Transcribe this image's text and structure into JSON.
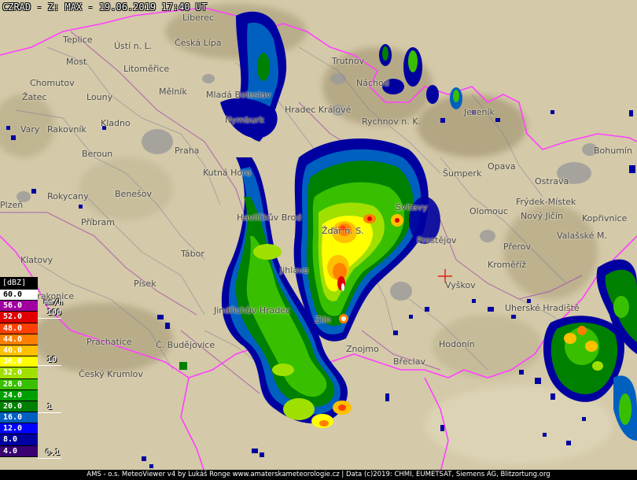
{
  "header": {
    "title": "CZRAD - Z: MAX - 19.06.2019 17:40 UT"
  },
  "legend": {
    "unit": "[dBZ]",
    "rate_unit": "mm/h",
    "levels": [
      {
        "label": "60.0",
        "color": "#ffffff",
        "text": "#000000"
      },
      {
        "label": "56.0",
        "color": "#a000a0",
        "text": "#ffffff"
      },
      {
        "label": "52.0",
        "color": "#e00000",
        "text": "#ffffff"
      },
      {
        "label": "48.0",
        "color": "#ff4000",
        "text": "#ffffff"
      },
      {
        "label": "44.0",
        "color": "#ff8000",
        "text": "#ffffff"
      },
      {
        "label": "40.0",
        "color": "#ffc000",
        "text": "#ffffff"
      },
      {
        "label": "36.0",
        "color": "#ffff00",
        "text": "#ffffff"
      },
      {
        "label": "32.0",
        "color": "#a0e000",
        "text": "#ffffff"
      },
      {
        "label": "28.0",
        "color": "#38c000",
        "text": "#ffffff"
      },
      {
        "label": "24.0",
        "color": "#00a000",
        "text": "#ffffff"
      },
      {
        "label": "20.0",
        "color": "#008000",
        "text": "#ffffff"
      },
      {
        "label": "16.0",
        "color": "#0060c0",
        "text": "#ffffff"
      },
      {
        "label": "12.0",
        "color": "#0000ff",
        "text": "#ffffff"
      },
      {
        "label": "8.0",
        "color": "#0000a0",
        "text": "#ffffff"
      },
      {
        "label": "4.0",
        "color": "#380070",
        "text": "#ffffff"
      }
    ],
    "rates": [
      "100",
      "10",
      "1",
      "0.1"
    ]
  },
  "cities": [
    {
      "name": "Liberec"
    },
    {
      "name": "Teplice"
    },
    {
      "name": "Ústí n. L."
    },
    {
      "name": "Česká Lípa"
    },
    {
      "name": "Most"
    },
    {
      "name": "Chomutov"
    },
    {
      "name": "Litoměřice"
    },
    {
      "name": "Trutnov"
    },
    {
      "name": "Náchod"
    },
    {
      "name": "Žatec"
    },
    {
      "name": "Louny"
    },
    {
      "name": "Mělník"
    },
    {
      "name": "Mladá Boleslav"
    },
    {
      "name": "Hradec Králové"
    },
    {
      "name": "Jeseník"
    },
    {
      "name": "Rakovník"
    },
    {
      "name": "Kladno"
    },
    {
      "name": "Nymburk"
    },
    {
      "name": "Rychnov n. K."
    },
    {
      "name": "Vary"
    },
    {
      "name": "Beroun"
    },
    {
      "name": "Praha"
    },
    {
      "name": "Kutná Hora"
    },
    {
      "name": "Šumperk"
    },
    {
      "name": "Opava"
    },
    {
      "name": "Bohumín"
    },
    {
      "name": "Ostrava"
    },
    {
      "name": "Rokycany"
    },
    {
      "name": "Benešov"
    },
    {
      "name": "Svitavy"
    },
    {
      "name": "Frýdek-Místek"
    },
    {
      "name": "Plzeň"
    },
    {
      "name": "Příbram"
    },
    {
      "name": "Havlíčkův Brod"
    },
    {
      "name": "Žďár n. S."
    },
    {
      "name": "Olomouc"
    },
    {
      "name": "Nový Jičín"
    },
    {
      "name": "Kopřivnice"
    },
    {
      "name": "Valašské M."
    },
    {
      "name": "Klatovy"
    },
    {
      "name": "Tábor"
    },
    {
      "name": "Prostějov"
    },
    {
      "name": "Přerov"
    },
    {
      "name": "Kroměříž"
    },
    {
      "name": "Jihlava"
    },
    {
      "name": "Vyškov"
    },
    {
      "name": "Písek"
    },
    {
      "name": "Strakonice"
    },
    {
      "name": "Jindřichův Hradec"
    },
    {
      "name": "Uherské Hradiště"
    },
    {
      "name": "Prachatice"
    },
    {
      "name": "Č. Budějovice"
    },
    {
      "name": "Znojmo"
    },
    {
      "name": "Hodonín"
    },
    {
      "name": "Zlín"
    },
    {
      "name": "Český Krumlov"
    },
    {
      "name": "Břeclav"
    }
  ],
  "footer": {
    "text": "AMS - o.s. MeteoViewer v4 by Lukáš Ronge www.amaterskameteorologie.cz | Data (c)2019: CHMI, EUMETSAT, Siemens AG, Blitzortung.org"
  }
}
